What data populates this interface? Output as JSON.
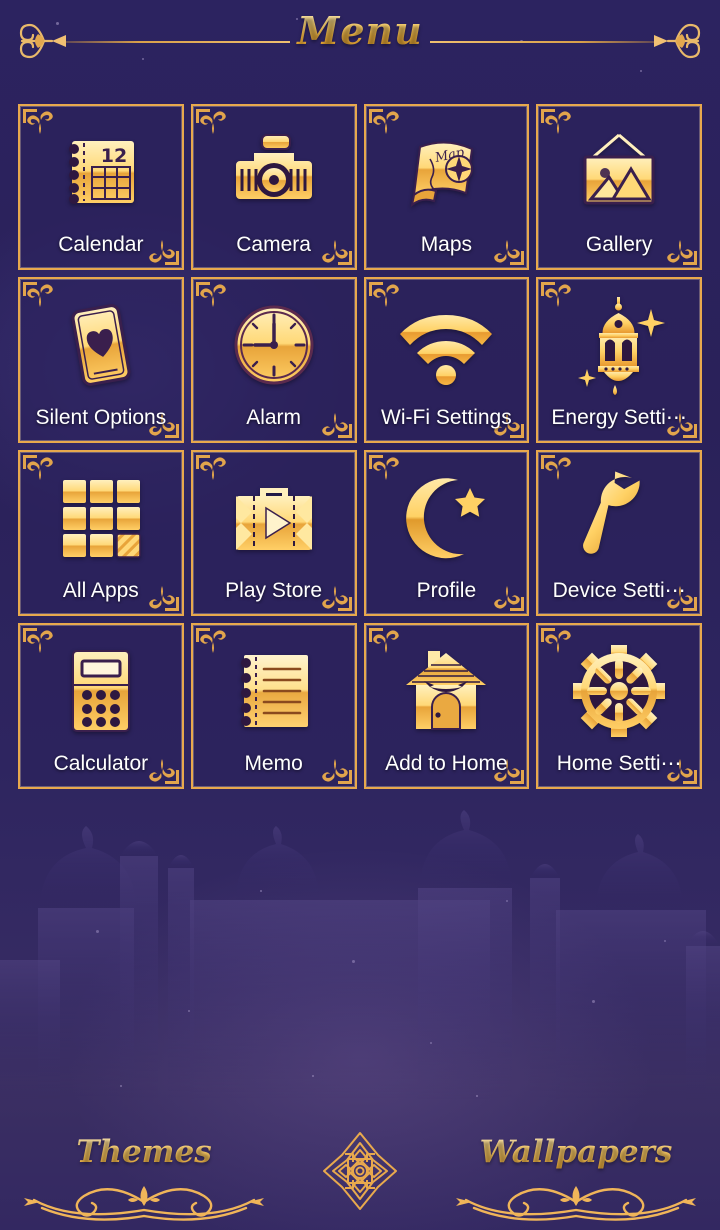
{
  "header": {
    "title": "Menu",
    "left_ornament": "flourish-ornament",
    "right_ornament": "flourish-ornament"
  },
  "theme": {
    "background_color": "#2b2259",
    "tile_border_color": "#e8a94d",
    "label_color": "#ffffff",
    "gold_light": "#fff3cd",
    "gold_mid": "#ffd271",
    "gold_dark": "#e09a26"
  },
  "grid": {
    "columns": 4,
    "rows": 4,
    "items": [
      {
        "label": "Calendar",
        "icon": "calendar-icon"
      },
      {
        "label": "Camera",
        "icon": "camera-icon"
      },
      {
        "label": "Maps",
        "icon": "map-scroll-icon"
      },
      {
        "label": "Gallery",
        "icon": "picture-frame-icon"
      },
      {
        "label": "Silent Options",
        "icon": "phone-heart-icon"
      },
      {
        "label": "Alarm",
        "icon": "clock-icon"
      },
      {
        "label": "Wi-Fi Settings",
        "icon": "wifi-icon"
      },
      {
        "label": "Energy Setti⋯",
        "icon": "lantern-icon"
      },
      {
        "label": "All Apps",
        "icon": "grid-apps-icon"
      },
      {
        "label": "Play Store",
        "icon": "suitcase-play-icon"
      },
      {
        "label": "Profile",
        "icon": "crescent-star-icon"
      },
      {
        "label": "Device Setti⋯",
        "icon": "wrench-icon"
      },
      {
        "label": "Calculator",
        "icon": "calculator-icon"
      },
      {
        "label": "Memo",
        "icon": "notepad-icon"
      },
      {
        "label": "Add to Home",
        "icon": "house-icon"
      },
      {
        "label": "Home Setti⋯",
        "icon": "gear-icon"
      }
    ]
  },
  "footer": {
    "themes_label": "Themes",
    "wallpapers_label": "Wallpapers",
    "center_ornament": "arabesque-medallion-icon"
  }
}
